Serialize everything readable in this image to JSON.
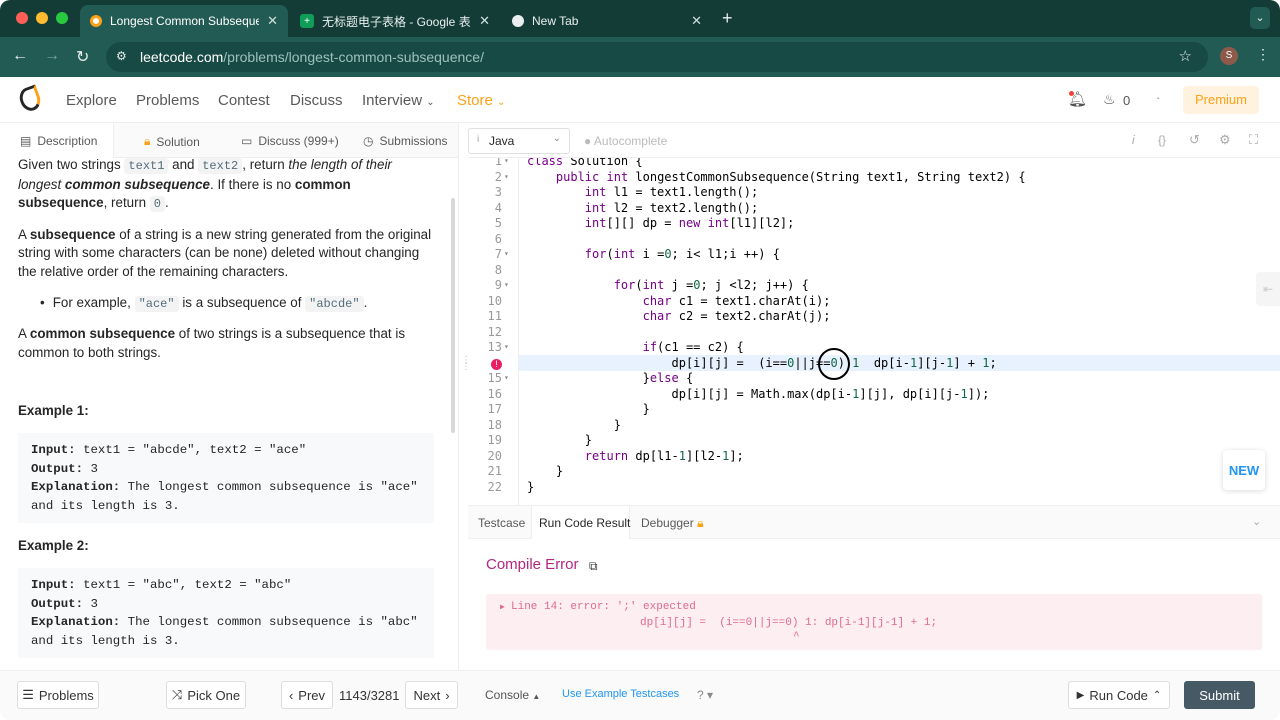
{
  "browser": {
    "tabs": [
      {
        "title": "Longest Common Subsequence",
        "active": true
      },
      {
        "title": "无标题电子表格 - Google 表格",
        "active": false
      },
      {
        "title": "New Tab",
        "active": false
      }
    ],
    "url_domain": "leetcode.com",
    "url_path": "/problems/longest-common-subsequence/",
    "profile_initial": "S"
  },
  "header": {
    "nav": [
      "Explore",
      "Problems",
      "Contest",
      "Discuss",
      "Interview",
      "Store"
    ],
    "streak": "0",
    "premium": "Premium"
  },
  "left_tabs": [
    "Description",
    "Solution",
    "Discuss (999+)",
    "Submissions"
  ],
  "description": {
    "p1_a": "Given two strings ",
    "p1_code1": "text1",
    "p1_b": " and ",
    "p1_code2": "text2",
    "p1_c": ", return ",
    "p1_em": "the length of their longest ",
    "p1_strong_em": "common subsequence",
    "p1_d": ". If there is no ",
    "p1_strong": "common subsequence",
    "p1_e": ", return ",
    "p1_code3": "0",
    "p1_f": ".",
    "p2_strong": "subsequence",
    "p2_a": "A ",
    "p2_b": " of a string is a new string generated from the original string with some characters (can be none) deleted without changing the relative order of the remaining characters.",
    "li_a": "For example, ",
    "li_code1": "\"ace\"",
    "li_b": " is a subsequence of ",
    "li_code2": "\"abcde\"",
    "li_c": ".",
    "p3_a": "A ",
    "p3_strong": "common subsequence",
    "p3_b": " of two strings is a subsequence that is common to both strings.",
    "examples": [
      {
        "title": "Example 1:",
        "input": "text1 = \"abcde\", text2 = \"ace\"",
        "output": "3",
        "explanation": "The longest common subsequence is \"ace\"\nand its length is 3."
      },
      {
        "title": "Example 2:",
        "input": "text1 = \"abc\", text2 = \"abc\"",
        "output": "3",
        "explanation": "The longest common subsequence is \"abc\"\nand its length is 3."
      }
    ],
    "labels": {
      "input": "Input:",
      "output": "Output:",
      "explanation": "Explanation:"
    }
  },
  "editor": {
    "language": "Java",
    "autocomplete": "Autocomplete",
    "error_line": 14,
    "lines": [
      "class Solution {",
      "    public int longestCommonSubsequence(String text1, String text2) {",
      "        int l1 = text1.length();",
      "        int l2 = text2.length();",
      "        int[][] dp = new int[l1][l2];",
      "",
      "        for(int i =0; i< l1;i ++) {",
      "",
      "            for(int j =0; j <l2; j++) {",
      "                char c1 = text1.charAt(i);",
      "                char c2 = text2.charAt(j);",
      "",
      "                if(c1 == c2) {",
      "                    dp[i][j] =  (i==0||j==0) 1  dp[i-1][j-1] + 1;",
      "                }else {",
      "                    dp[i][j] = Math.max(dp[i-1][j], dp[i][j-1]);",
      "                }",
      "            }",
      "        }",
      "        return dp[l1-1][l2-1];",
      "    }",
      "}"
    ],
    "foldable": [
      1,
      2,
      7,
      9,
      13,
      15
    ]
  },
  "result": {
    "tabs": [
      "Testcase",
      "Run Code Result",
      "Debugger"
    ],
    "title": "Compile Error",
    "error_line1": "Line 14: error: ';' expected",
    "error_line2": "dp[i][j] =  (i==0||j==0) 1: dp[i-1][j-1] + 1;",
    "error_caret": "^"
  },
  "bottom": {
    "problems": "Problems",
    "pick_one": "Pick One",
    "prev": "Prev",
    "counter": "1143/3281",
    "next": "Next",
    "console": "Console",
    "use_example": "Use Example Testcases",
    "run_code": "Run Code",
    "submit": "Submit"
  },
  "new_badge": "NEW",
  "colors": {
    "accent": "#ffa116",
    "tab_bar": "#143c37",
    "address_bar": "#225b53",
    "error": "#b4277f",
    "submit": "#455a64"
  }
}
